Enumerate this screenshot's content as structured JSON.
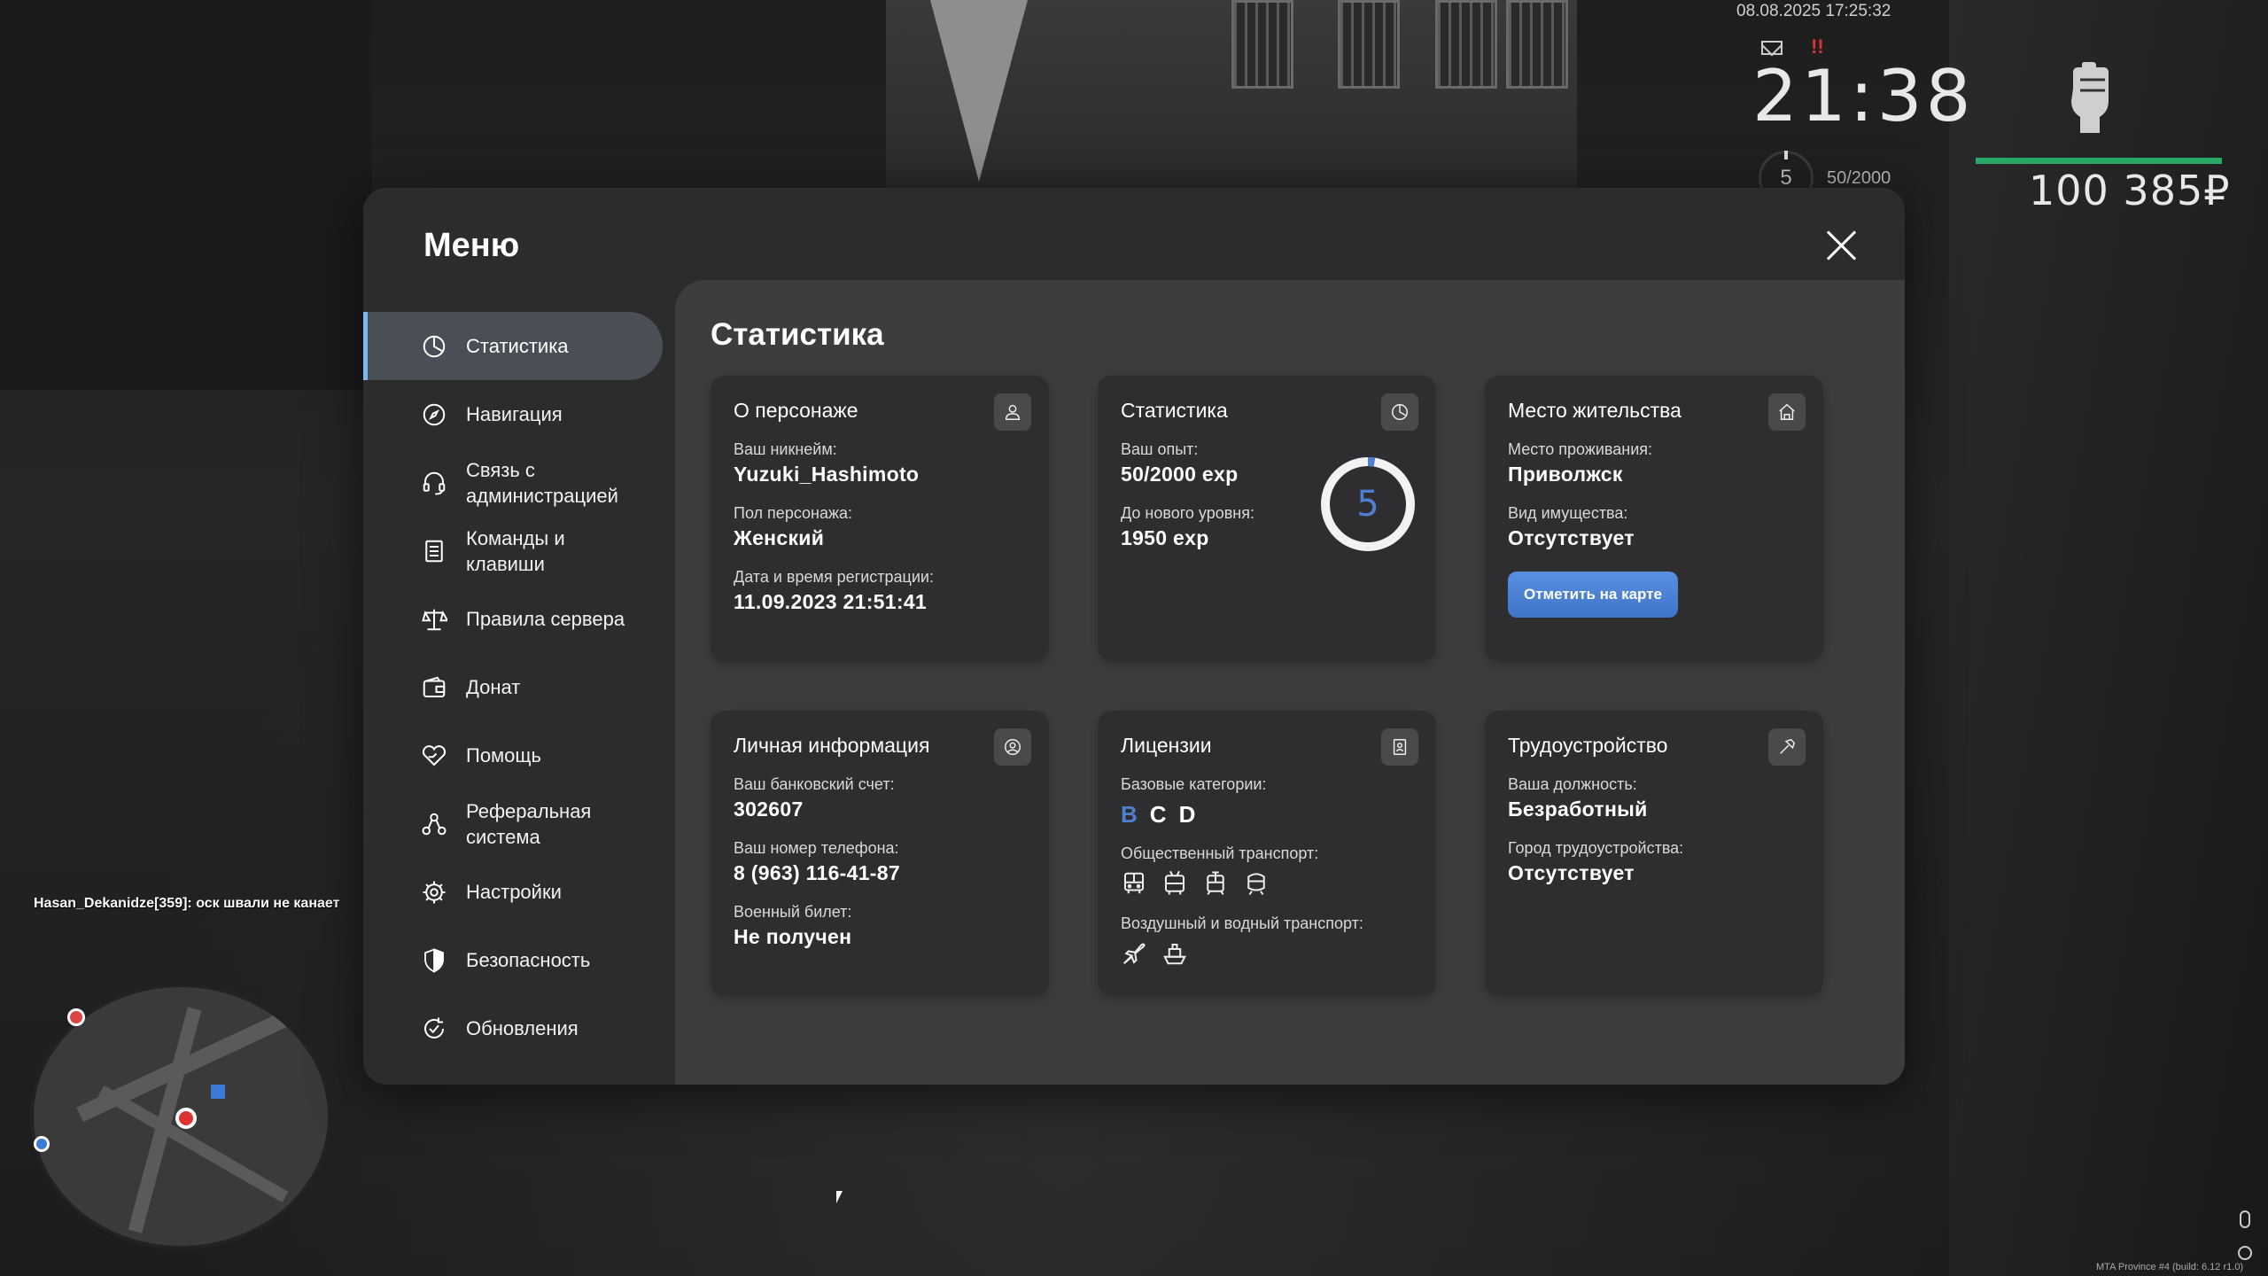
{
  "hud": {
    "datetime": "08.08.2025 17:25:32",
    "alert": "!!",
    "clock": "21:38",
    "level": "5",
    "exp": "50/2000",
    "money": "100 385₽",
    "health_percent": 100
  },
  "chat": {
    "line": "Hasan_Dekanidze[359]: оск швали не канает"
  },
  "build_info": "MTA Province #4 (build: 6.12 r1.0)",
  "menu": {
    "title": "Меню",
    "items": [
      {
        "label": "Статистика",
        "icon": "pie-chart-icon",
        "active": true
      },
      {
        "label": "Навигация",
        "icon": "compass-icon"
      },
      {
        "label": "Связь с администрацией",
        "icon": "headset-icon"
      },
      {
        "label": "Команды и клавиши",
        "icon": "document-icon"
      },
      {
        "label": "Правила сервера",
        "icon": "scales-icon"
      },
      {
        "label": "Донат",
        "icon": "wallet-icon"
      },
      {
        "label": "Помощь",
        "icon": "handshake-heart-icon"
      },
      {
        "label": "Реферальная система",
        "icon": "referral-icon"
      },
      {
        "label": "Настройки",
        "icon": "gear-icon"
      },
      {
        "label": "Безопасность",
        "icon": "shield-icon"
      },
      {
        "label": "Обновления",
        "icon": "refresh-check-icon"
      }
    ]
  },
  "content": {
    "title": "Статистика",
    "character": {
      "title": "О персонаже",
      "nick_label": "Ваш никнейм:",
      "nick": "Yuzuki_Hashimoto",
      "gender_label": "Пол персонажа:",
      "gender": "Женский",
      "reg_label": "Дата и время регистрации:",
      "reg": "11.09.2023 21:51:41"
    },
    "stats": {
      "title": "Статистика",
      "exp_label": "Ваш опыт:",
      "exp": "50/2000 exp",
      "next_label": "До нового уровня:",
      "next": "1950 exp",
      "level": "5",
      "progress": 0.025
    },
    "residence": {
      "title": "Место жительства",
      "place_label": "Место проживания:",
      "place": "Приволжск",
      "property_label": "Вид имущества:",
      "property": "Отсутствует",
      "map_button": "Отметить на карте"
    },
    "personal": {
      "title": "Личная информация",
      "bank_label": "Ваш банковский счет:",
      "bank": "302607",
      "phone_label": "Ваш номер телефона:",
      "phone": "8 (963) 116-41-87",
      "military_label": "Военный билет:",
      "military": "Не получен"
    },
    "licenses": {
      "title": "Лицензии",
      "base_label": "Базовые категории:",
      "cat_b": "B",
      "cat_c": "C",
      "cat_d": "D",
      "public_label": "Общественный транспорт:",
      "air_label": "Воздушный и водный транспорт:"
    },
    "employment": {
      "title": "Трудоустройство",
      "position_label": "Ваша должность:",
      "position": "Безработный",
      "city_label": "Город трудоустройства:",
      "city": "Отсутствует"
    }
  },
  "colors": {
    "accent": "#4f7fd1",
    "active_border": "#79b8f0",
    "hp": "#27a865"
  }
}
